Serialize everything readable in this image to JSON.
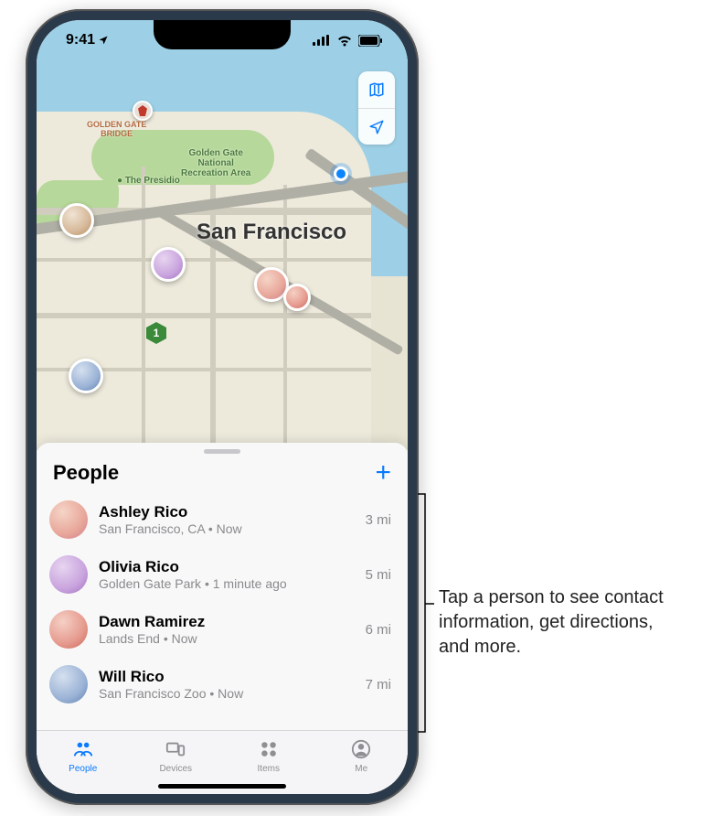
{
  "status": {
    "time": "9:41"
  },
  "map": {
    "city_label": "San Francisco",
    "poi": {
      "golden_gate_bridge": "GOLDEN GATE\nBRIDGE",
      "recreation_area": "Golden Gate\nNational\nRecreation Area",
      "presidio": "The Presidio"
    },
    "route_badge": "1"
  },
  "sheet": {
    "title": "People",
    "add_label": "+"
  },
  "people": [
    {
      "name": "Ashley Rico",
      "sub": "San Francisco, CA • Now",
      "distance": "3 mi",
      "avatar": "av-pink"
    },
    {
      "name": "Olivia Rico",
      "sub": "Golden Gate Park • 1 minute ago",
      "distance": "5 mi",
      "avatar": "av-purple"
    },
    {
      "name": "Dawn Ramirez",
      "sub": "Lands End • Now",
      "distance": "6 mi",
      "avatar": "av-red"
    },
    {
      "name": "Will Rico",
      "sub": "San Francisco Zoo • Now",
      "distance": "7 mi",
      "avatar": "av-blue"
    }
  ],
  "tabs": [
    {
      "id": "people",
      "label": "People",
      "active": true
    },
    {
      "id": "devices",
      "label": "Devices",
      "active": false
    },
    {
      "id": "items",
      "label": "Items",
      "active": false
    },
    {
      "id": "me",
      "label": "Me",
      "active": false
    }
  ],
  "callout": "Tap a person to see contact information, get directions, and more."
}
